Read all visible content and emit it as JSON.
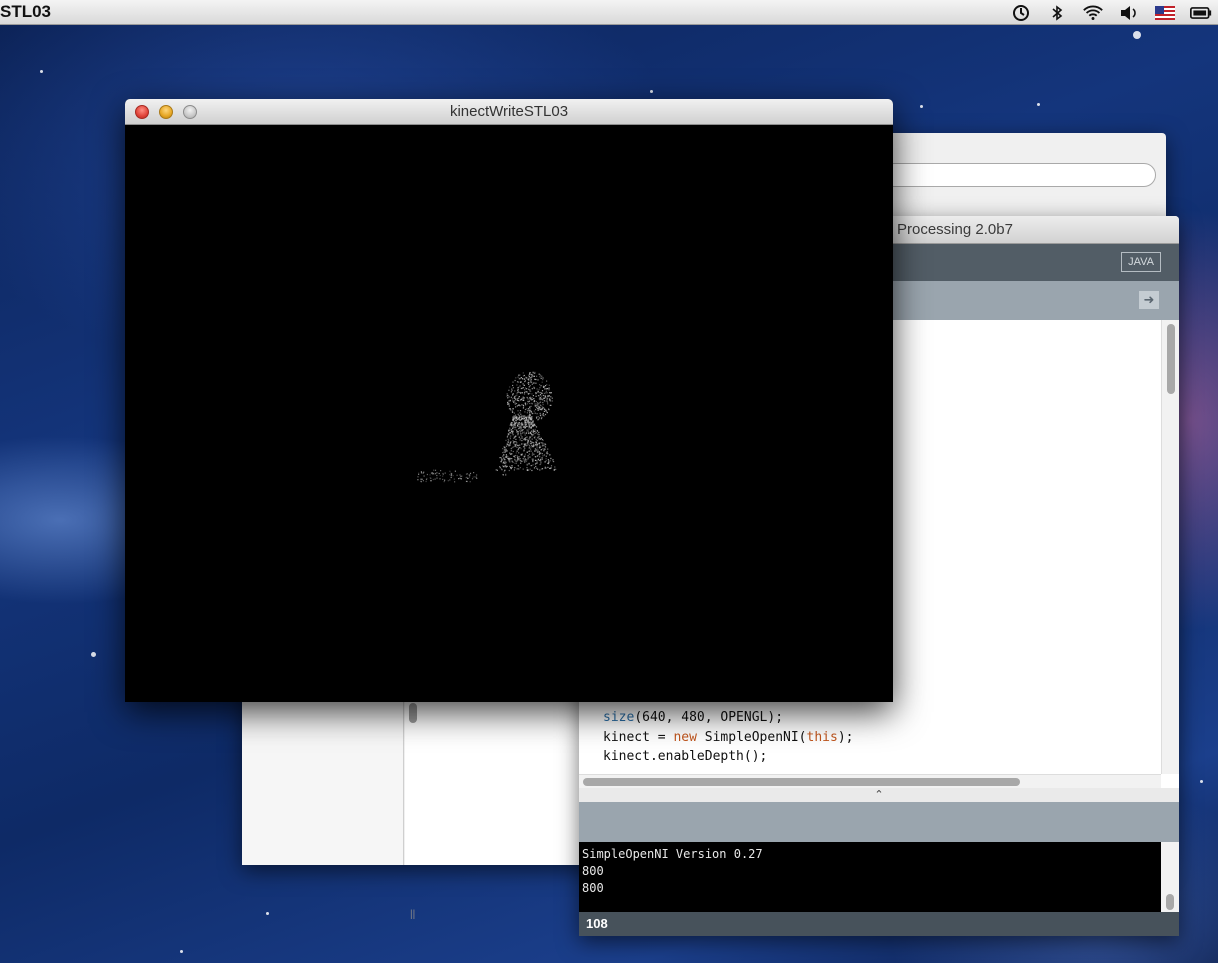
{
  "menubar": {
    "app_name": "STL03",
    "extras_icons": [
      "time-machine-icon",
      "bluetooth-icon",
      "wifi-icon",
      "volume-icon",
      "us-flag-icon",
      "battery-icon"
    ]
  },
  "sketch_window": {
    "title": "kinectWriteSTL03"
  },
  "processing_window": {
    "title": "Processing 2.0b7",
    "mode_button": "JAVA",
    "code": {
      "line1_fn": "size",
      "line1_rest": "(640, 480, OPENGL);",
      "line2_a": "kinect = ",
      "line2_kw": "new",
      "line2_b": " SimpleOpenNI(",
      "line2_kw2": "this",
      "line2_c": ");",
      "line3": "kinect.enableDepth();"
    },
    "console": [
      "SimpleOpenNI Version 0.27",
      "800",
      "800"
    ],
    "status_line": "108"
  },
  "colors": {
    "toolbar": "#525d66",
    "tab_bar": "#9aa5ae",
    "status_bar": "#47525b",
    "keyword_fn": "#2a6fa8",
    "keyword": "#c2561d"
  }
}
